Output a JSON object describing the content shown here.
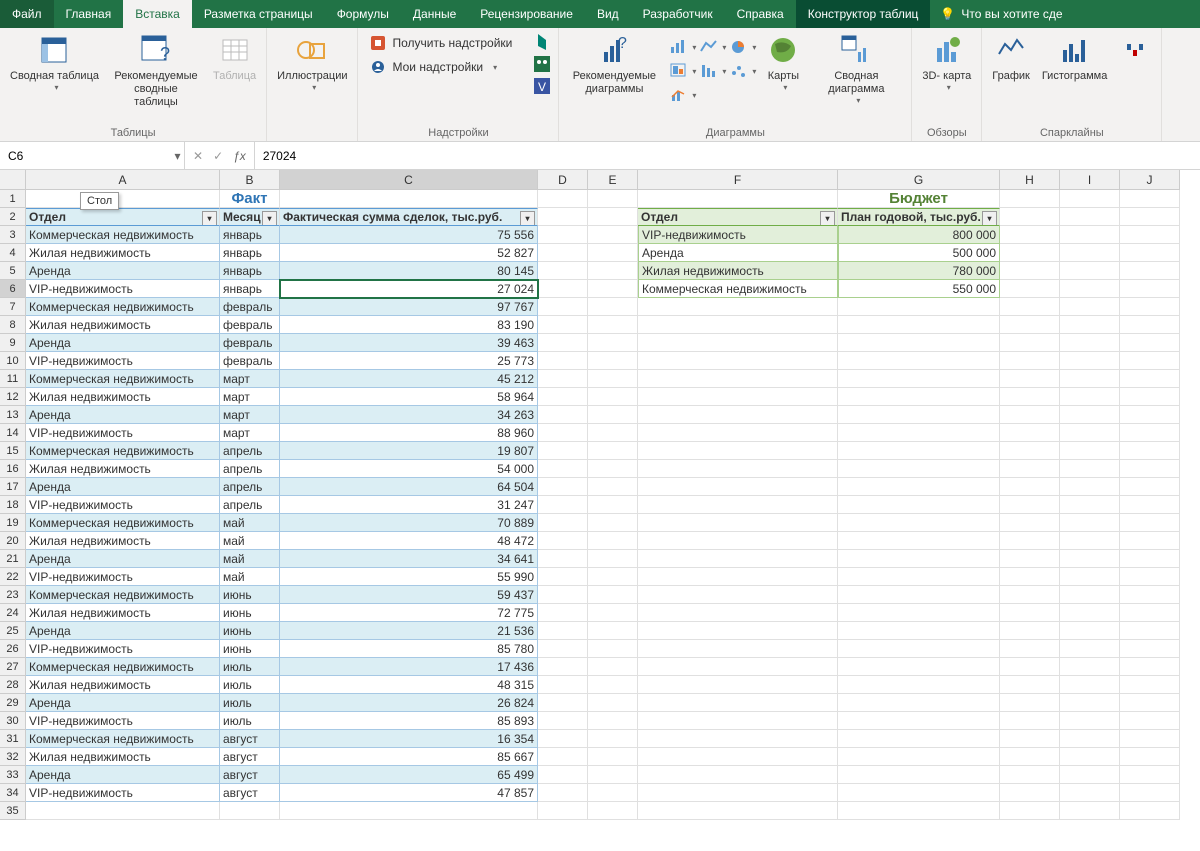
{
  "tabs": [
    "Файл",
    "Главная",
    "Вставка",
    "Разметка страницы",
    "Формулы",
    "Данные",
    "Рецензирование",
    "Вид",
    "Разработчик",
    "Справка",
    "Конструктор таблиц"
  ],
  "active_tab": 2,
  "tell_me": "Что вы хотите сде",
  "ribbon": {
    "pivot": "Сводная\nтаблица",
    "rec_pivot": "Рекомендуемые\nсводные таблицы",
    "table": "Таблица",
    "group_tables": "Таблицы",
    "illustrations": "Иллюстрации",
    "get_addins": "Получить надстройки",
    "my_addins": "Мои надстройки",
    "group_addins": "Надстройки",
    "rec_charts": "Рекомендуемые\nдиаграммы",
    "maps": "Карты",
    "pivot_chart": "Сводная\nдиаграмма",
    "group_charts": "Диаграммы",
    "map3d": "3D-\nкарта",
    "group_tours": "Обзоры",
    "sparkline_line": "График",
    "sparkline_bar": "Гистограмма",
    "group_spark": "Спарклайны"
  },
  "namebox": "C6",
  "formula": "27024",
  "tooltip": "Стол",
  "columns": [
    "A",
    "B",
    "C",
    "D",
    "E",
    "F",
    "G",
    "H",
    "I",
    "J"
  ],
  "titles": {
    "fact": "Факт",
    "budget": "Бюджет"
  },
  "fact_headers": [
    "Отдел",
    "Месяц",
    "Фактическая сумма сделок, тыс.руб."
  ],
  "budget_headers": [
    "Отдел",
    "План годовой, тыс.руб."
  ],
  "fact_rows": [
    [
      "Коммерческая недвижимость",
      "январь",
      "75 556"
    ],
    [
      "Жилая недвижимость",
      "январь",
      "52 827"
    ],
    [
      "Аренда",
      "январь",
      "80 145"
    ],
    [
      "VIP-недвижимость",
      "январь",
      "27 024"
    ],
    [
      "Коммерческая недвижимость",
      "февраль",
      "97 767"
    ],
    [
      "Жилая недвижимость",
      "февраль",
      "83 190"
    ],
    [
      "Аренда",
      "февраль",
      "39 463"
    ],
    [
      "VIP-недвижимость",
      "февраль",
      "25 773"
    ],
    [
      "Коммерческая недвижимость",
      "март",
      "45 212"
    ],
    [
      "Жилая недвижимость",
      "март",
      "58 964"
    ],
    [
      "Аренда",
      "март",
      "34 263"
    ],
    [
      "VIP-недвижимость",
      "март",
      "88 960"
    ],
    [
      "Коммерческая недвижимость",
      "апрель",
      "19 807"
    ],
    [
      "Жилая недвижимость",
      "апрель",
      "54 000"
    ],
    [
      "Аренда",
      "апрель",
      "64 504"
    ],
    [
      "VIP-недвижимость",
      "апрель",
      "31 247"
    ],
    [
      "Коммерческая недвижимость",
      "май",
      "70 889"
    ],
    [
      "Жилая недвижимость",
      "май",
      "48 472"
    ],
    [
      "Аренда",
      "май",
      "34 641"
    ],
    [
      "VIP-недвижимость",
      "май",
      "55 990"
    ],
    [
      "Коммерческая недвижимость",
      "июнь",
      "59 437"
    ],
    [
      "Жилая недвижимость",
      "июнь",
      "72 775"
    ],
    [
      "Аренда",
      "июнь",
      "21 536"
    ],
    [
      "VIP-недвижимость",
      "июнь",
      "85 780"
    ],
    [
      "Коммерческая недвижимость",
      "июль",
      "17 436"
    ],
    [
      "Жилая недвижимость",
      "июль",
      "48 315"
    ],
    [
      "Аренда",
      "июль",
      "26 824"
    ],
    [
      "VIP-недвижимость",
      "июль",
      "85 893"
    ],
    [
      "Коммерческая недвижимость",
      "август",
      "16 354"
    ],
    [
      "Жилая недвижимость",
      "август",
      "85 667"
    ],
    [
      "Аренда",
      "август",
      "65 499"
    ],
    [
      "VIP-недвижимость",
      "август",
      "47 857"
    ]
  ],
  "budget_rows": [
    [
      "VIP-недвижимость",
      "800 000"
    ],
    [
      "Аренда",
      "500 000"
    ],
    [
      "Жилая недвижимость",
      "780 000"
    ],
    [
      "Коммерческая недвижимость",
      "550 000"
    ]
  ],
  "active_cell_ref": "C6"
}
